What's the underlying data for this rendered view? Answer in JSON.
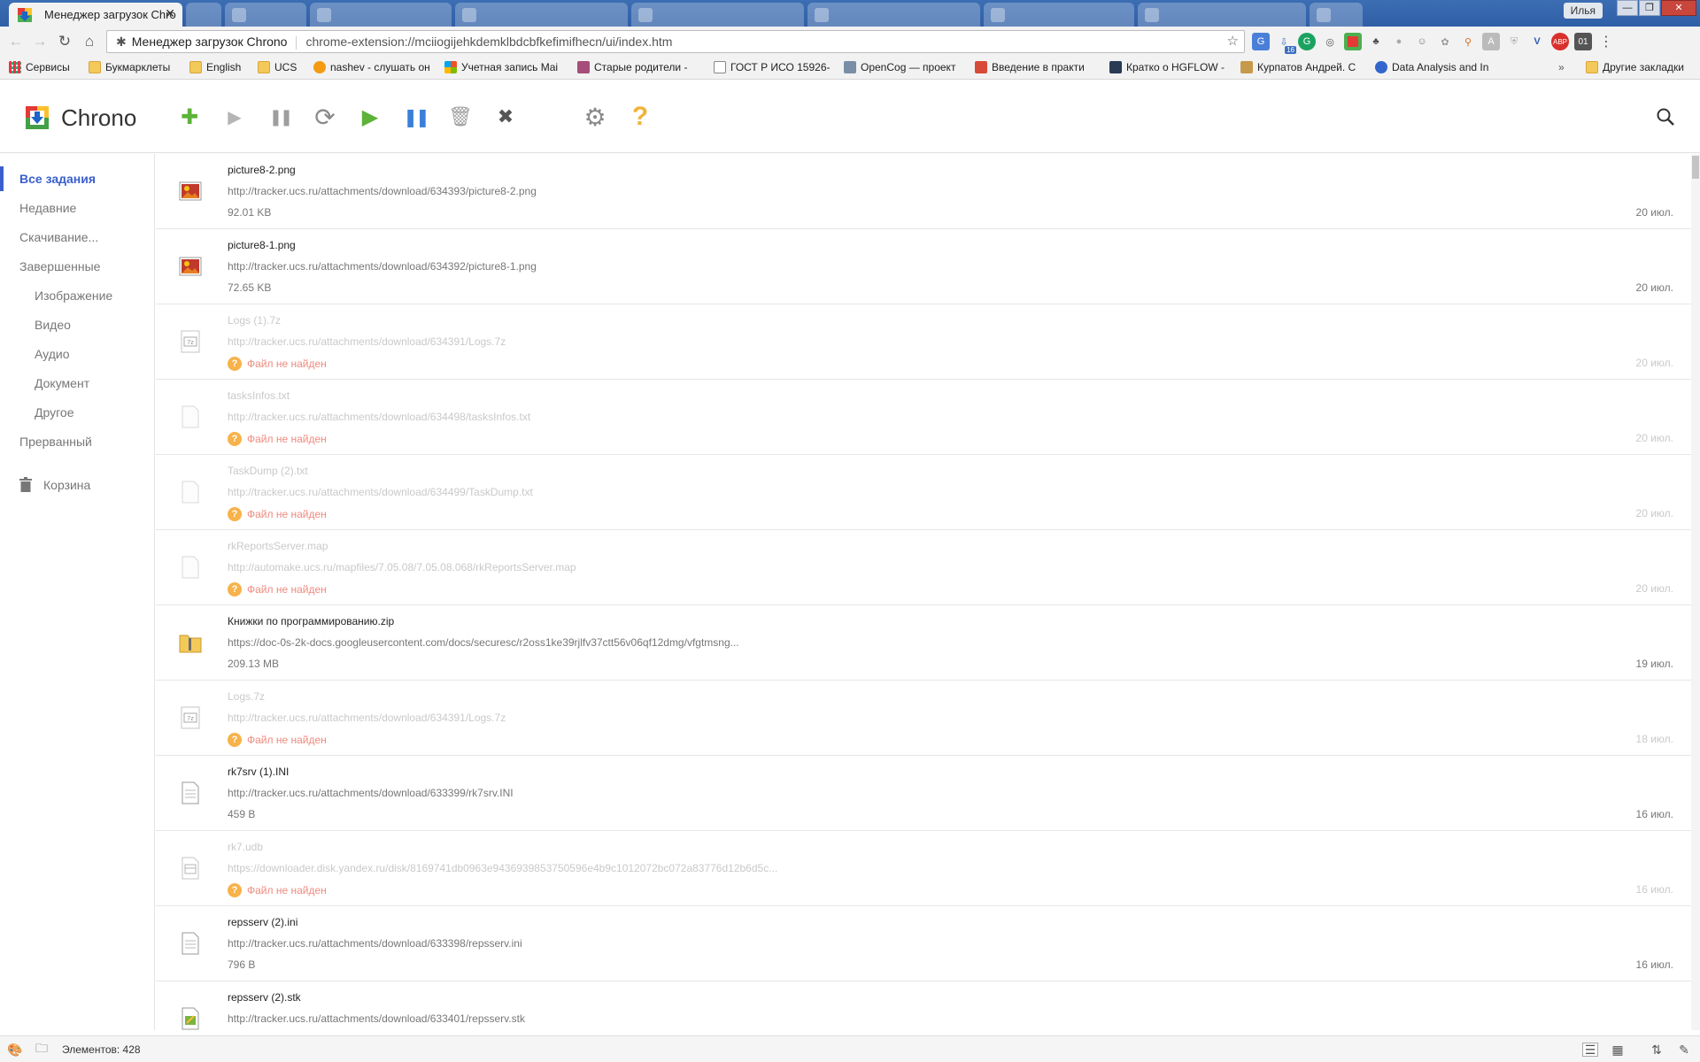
{
  "browser": {
    "active_tab_title": "Менеджер загрузок Chro",
    "close_glyph": "✕",
    "user_chip": "Илья",
    "window_controls": {
      "minimize": "—",
      "maximize": "❐",
      "close": "✕"
    },
    "back_glyph": "←",
    "forward_glyph": "→",
    "reload_glyph": "↻",
    "home_glyph": "⌂",
    "omnibox": {
      "extension_name": "Менеджер загрузок Chrono",
      "url": "chrome-extension://mciiogijehkdemklbdcbfkefimifhecn/ui/index.htm",
      "star_glyph": "☆"
    },
    "extension_badge": "16",
    "bookmarks_overflow": "»",
    "bookmarks": [
      {
        "label": "Сервисы",
        "icon": "apps-icon"
      },
      {
        "label": "Букмарклеты",
        "icon": "folder-icon"
      },
      {
        "label": "English",
        "icon": "folder-icon"
      },
      {
        "label": "UCS",
        "icon": "folder-icon"
      },
      {
        "label": "nashev - слушать он",
        "icon": "site-icon"
      },
      {
        "label": "Учетная запись Mai",
        "icon": "microsoft-icon"
      },
      {
        "label": "Старые родители -",
        "icon": "site-icon"
      },
      {
        "label": "ГОСТ Р ИСО 15926-",
        "icon": "page-icon"
      },
      {
        "label": "OpenCog — проект",
        "icon": "site-icon"
      },
      {
        "label": "Введение в практи",
        "icon": "site-icon"
      },
      {
        "label": "Кратко о HGFLOW -",
        "icon": "site-icon"
      },
      {
        "label": "Курпатов Андрей. С",
        "icon": "site-icon"
      },
      {
        "label": "Data Analysis and In",
        "icon": "site-icon"
      }
    ],
    "other_bookmarks": "Другие закладки"
  },
  "app": {
    "title": "Chrono",
    "toolbar": [
      {
        "name": "add-icon",
        "glyph": "✚",
        "color": "#5cb338"
      },
      {
        "name": "play-icon",
        "glyph": "▶",
        "color": "#b5b5b5"
      },
      {
        "name": "pause-icon",
        "glyph": "❚❚",
        "color": "#9e9e9e"
      },
      {
        "name": "retry-icon",
        "glyph": "⟳",
        "color": "#8a8a8a"
      },
      {
        "name": "start-all-icon",
        "glyph": "▶",
        "color": "#5cb338"
      },
      {
        "name": "pause-all-icon",
        "glyph": "❚❚",
        "color": "#3a7fd9"
      },
      {
        "name": "clear-icon",
        "glyph": "🗑",
        "color": "#9e9e9e"
      },
      {
        "name": "cancel-icon",
        "glyph": "✖",
        "color": "#555555"
      },
      {
        "name": "settings-icon",
        "glyph": "⚙",
        "color": "#8a8a8a"
      },
      {
        "name": "help-icon",
        "glyph": "?",
        "color": "#f0b43a"
      }
    ],
    "search_icon": "search-icon"
  },
  "sidebar": {
    "items": [
      {
        "label": "Все задания",
        "level": 0,
        "active": true
      },
      {
        "label": "Недавние",
        "level": 0
      },
      {
        "label": "Скачивание...",
        "level": 0
      },
      {
        "label": "Завершенные",
        "level": 0
      },
      {
        "label": "Изображение",
        "level": 1
      },
      {
        "label": "Видео",
        "level": 1
      },
      {
        "label": "Аудио",
        "level": 1
      },
      {
        "label": "Документ",
        "level": 1
      },
      {
        "label": "Другое",
        "level": 1
      },
      {
        "label": "Прерванный",
        "level": 0
      }
    ],
    "trash_label": "Корзина"
  },
  "downloads": [
    {
      "name": "picture8-2.png",
      "url": "http://tracker.ucs.ru/attachments/download/634393/picture8-2.png",
      "meta": "92.01 KB",
      "date": "20 июл.",
      "status": "ok",
      "icon": "image-file-icon"
    },
    {
      "name": "picture8-1.png",
      "url": "http://tracker.ucs.ru/attachments/download/634392/picture8-1.png",
      "meta": "72.65 KB",
      "date": "20 июл.",
      "status": "ok",
      "icon": "image-file-icon"
    },
    {
      "name": "Logs (1).7z",
      "url": "http://tracker.ucs.ru/attachments/download/634391/Logs.7z",
      "meta": "Файл не найден",
      "date": "20 июл.",
      "status": "failed",
      "icon": "archive-7z-icon"
    },
    {
      "name": "tasksInfos.txt",
      "url": "http://tracker.ucs.ru/attachments/download/634498/tasksInfos.txt",
      "meta": "Файл не найден",
      "date": "20 июл.",
      "status": "failed",
      "icon": "text-file-icon"
    },
    {
      "name": "TaskDump (2).txt",
      "url": "http://tracker.ucs.ru/attachments/download/634499/TaskDump.txt",
      "meta": "Файл не найден",
      "date": "20 июл.",
      "status": "failed",
      "icon": "text-file-icon"
    },
    {
      "name": "rkReportsServer.map",
      "url": "http://automake.ucs.ru/mapfiles/7.05.08/7.05.08.068/rkReportsServer.map",
      "meta": "Файл не найден",
      "date": "20 июл.",
      "status": "failed",
      "icon": "blank-file-icon"
    },
    {
      "name": "Книжки по программированию.zip",
      "url": "https://doc-0s-2k-docs.googleusercontent.com/docs/securesc/r2oss1ke39rjlfv37ctt56v06qf12dmg/vfgtmsng...",
      "meta": "209.13 MB",
      "date": "19 июл.",
      "status": "ok",
      "icon": "zip-folder-icon"
    },
    {
      "name": "Logs.7z",
      "url": "http://tracker.ucs.ru/attachments/download/634391/Logs.7z",
      "meta": "Файл не найден",
      "date": "18 июл.",
      "status": "failed",
      "icon": "archive-7z-icon"
    },
    {
      "name": "rk7srv (1).INI",
      "url": "http://tracker.ucs.ru/attachments/download/633399/rk7srv.INI",
      "meta": "459 B",
      "date": "16 июл.",
      "status": "ok",
      "icon": "ini-file-icon"
    },
    {
      "name": "rk7.udb",
      "url": "https://downloader.disk.yandex.ru/disk/8169741db0963e9436939853750596e4b9c1012072bc072a83776d12b6d5c...",
      "meta": "Файл не найден",
      "date": "16 июл.",
      "status": "failed",
      "icon": "database-file-icon"
    },
    {
      "name": "repsserv (2).ini",
      "url": "http://tracker.ucs.ru/attachments/download/633398/repsserv.ini",
      "meta": "796 B",
      "date": "16 июл.",
      "status": "ok",
      "icon": "ini-file-icon"
    },
    {
      "name": "repsserv (2).stk",
      "url": "http://tracker.ucs.ru/attachments/download/633401/repsserv.stk",
      "meta": "",
      "date": "",
      "status": "ok",
      "icon": "stk-file-icon"
    }
  ],
  "statusbar": {
    "text": "Элементов: 428"
  }
}
